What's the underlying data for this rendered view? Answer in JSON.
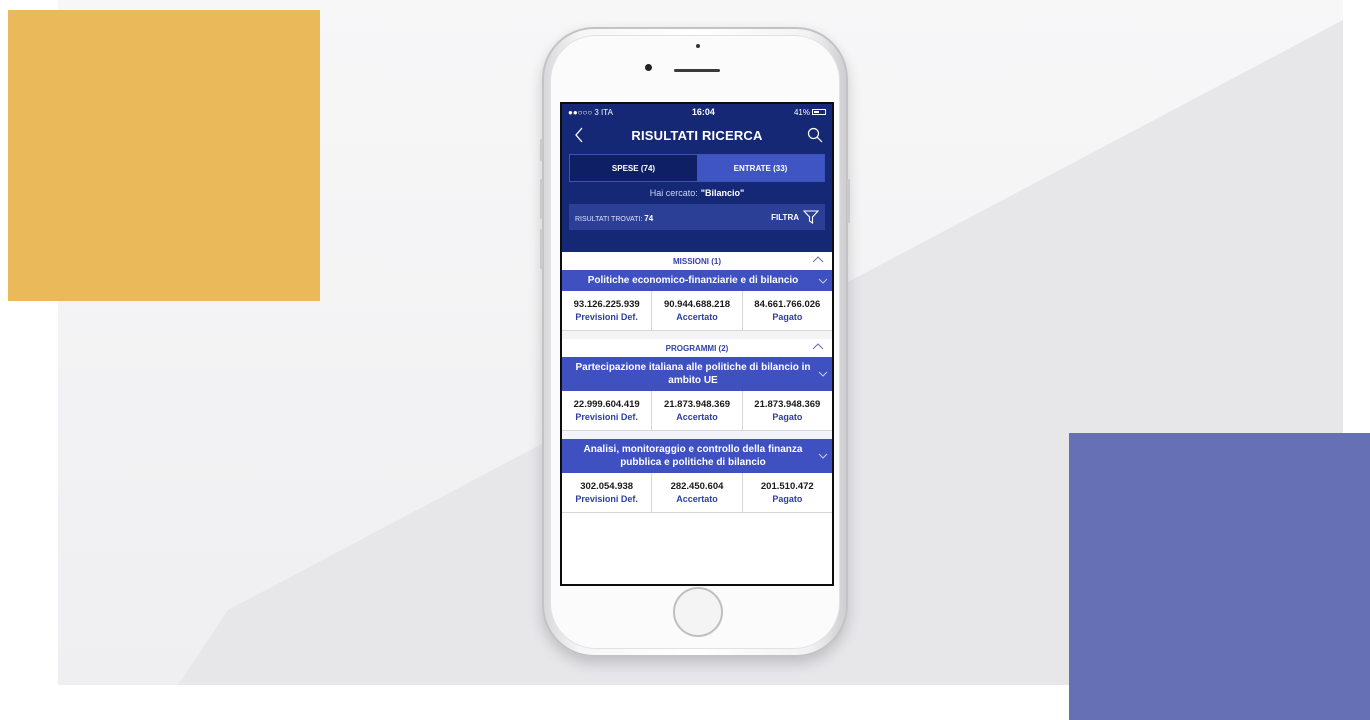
{
  "status_bar": {
    "carrier": "●●○○○ 3 ITA",
    "time": "16:04",
    "battery": "41%"
  },
  "nav": {
    "title": "RISULTATI RICERCA"
  },
  "tabs": [
    {
      "label": "SPESE (74)"
    },
    {
      "label": "ENTRATE (33)"
    }
  ],
  "search": {
    "prefix": "Hai cercato:",
    "query": "\"Bilancio\""
  },
  "results": {
    "label": "RISULTATI TROVATI:",
    "count": "74",
    "filter_label": "FILTRA"
  },
  "sections": [
    {
      "header": "MISSIONI (1)",
      "items": [
        {
          "title": "Politiche economico-finanziarie e di bilancio",
          "stats": [
            {
              "value": "93.126.225.939",
              "label": "Previsioni Def."
            },
            {
              "value": "90.944.688.218",
              "label": "Accertato"
            },
            {
              "value": "84.661.766.026",
              "label": "Pagato"
            }
          ]
        }
      ]
    },
    {
      "header": "PROGRAMMI (2)",
      "items": [
        {
          "title": "Partecipazione italiana alle politiche di bilancio in ambito UE",
          "stats": [
            {
              "value": "22.999.604.419",
              "label": "Previsioni Def."
            },
            {
              "value": "21.873.948.369",
              "label": "Accertato"
            },
            {
              "value": "21.873.948.369",
              "label": "Pagato"
            }
          ]
        },
        {
          "title": "Analisi, monitoraggio e controllo della finanza pubblica e politiche di bilancio",
          "stats": [
            {
              "value": "302.054.938",
              "label": "Previsioni Def."
            },
            {
              "value": "282.450.604",
              "label": "Accertato"
            },
            {
              "value": "201.510.472",
              "label": "Pagato"
            }
          ]
        }
      ]
    }
  ],
  "colors": {
    "yellow_block": "#eab95a",
    "purple_block": "#6670b4",
    "app_navy": "#142876",
    "app_blue": "#3f50c0"
  }
}
